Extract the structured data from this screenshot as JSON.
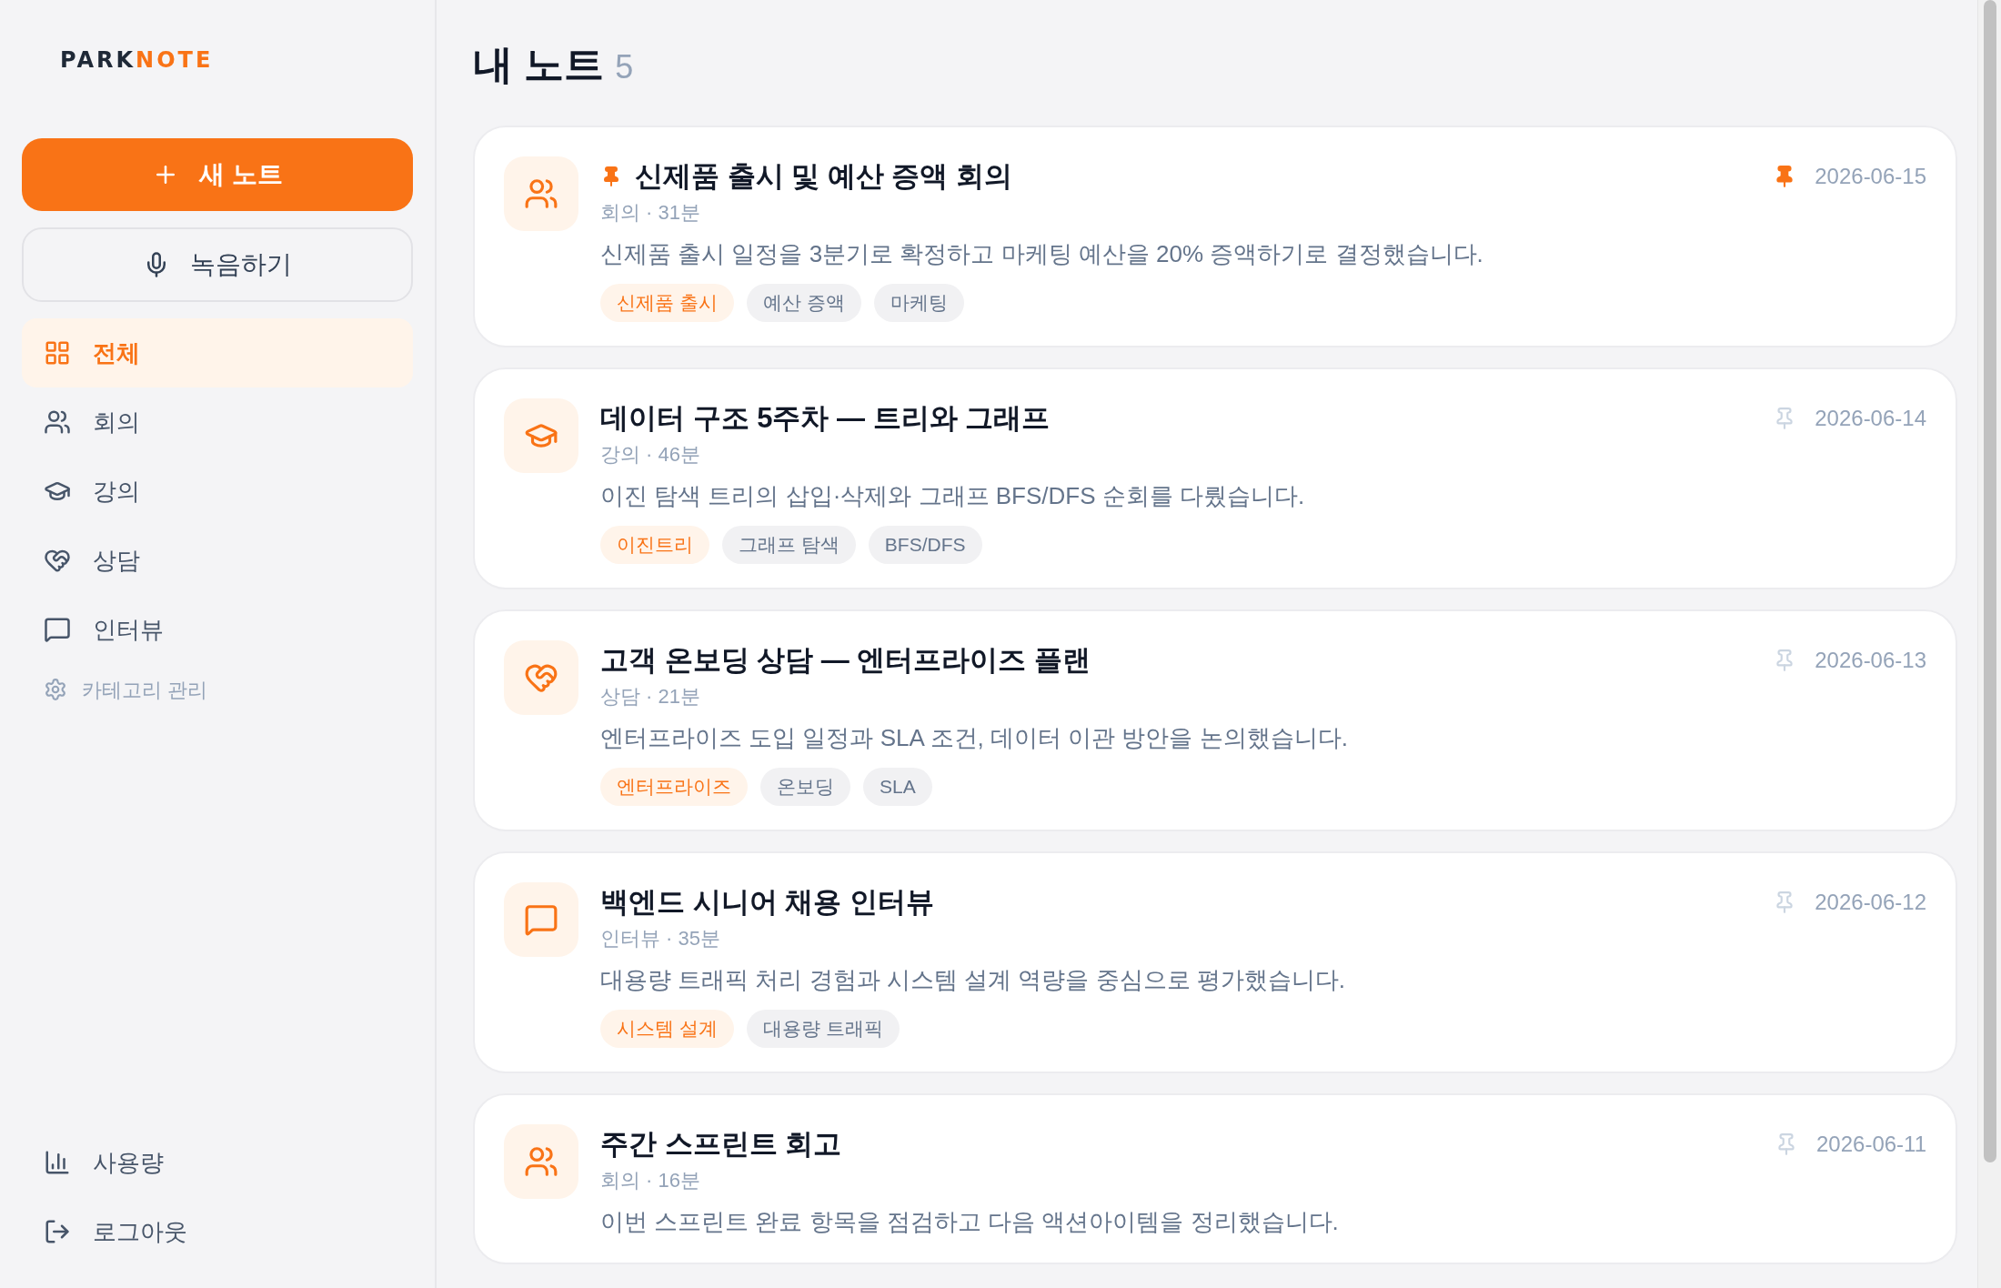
{
  "logo": {
    "part_1": "PARK",
    "part_2": "NOTE"
  },
  "new_note_button": {
    "label": "새 노트"
  },
  "record_button": {
    "label": "녹음하기"
  },
  "sidebar": {
    "items": [
      {
        "kind": "all",
        "label": "전체",
        "selected": true
      },
      {
        "kind": "meeting",
        "label": "회의",
        "selected": false
      },
      {
        "kind": "lecture",
        "label": "강의",
        "selected": false
      },
      {
        "kind": "consult",
        "label": "상담",
        "selected": false
      },
      {
        "kind": "interview",
        "label": "인터뷰",
        "selected": false
      },
      {
        "kind": "manage",
        "label": "카테고리 관리",
        "selected": false
      }
    ],
    "bottom_items": [
      {
        "kind": "usage",
        "label": "사용량"
      },
      {
        "kind": "logout",
        "label": "로그아웃"
      }
    ]
  },
  "page": {
    "title": "내 노트",
    "count": "5"
  },
  "notes": [
    {
      "kind": "meeting",
      "pinned": true,
      "title": "신제품 출시 및 예산 증액 회의",
      "meta": "회의 · 31분",
      "date": "2026-06-15",
      "summary": "신제품 출시 일정을 3분기로 확정하고 마케팅 예산을 20% 증액하기로 결정했습니다.",
      "tags": [
        {
          "label": "신제품 출시",
          "primary": true
        },
        {
          "label": "예산 증액",
          "primary": false
        },
        {
          "label": "마케팅",
          "primary": false
        }
      ]
    },
    {
      "kind": "lecture",
      "pinned": false,
      "title": "데이터 구조 5주차 — 트리와 그래프",
      "meta": "강의 · 46분",
      "date": "2026-06-14",
      "summary": "이진 탐색 트리의 삽입·삭제와 그래프 BFS/DFS 순회를 다뤘습니다.",
      "tags": [
        {
          "label": "이진트리",
          "primary": true
        },
        {
          "label": "그래프 탐색",
          "primary": false
        },
        {
          "label": "BFS/DFS",
          "primary": false
        }
      ]
    },
    {
      "kind": "consult",
      "pinned": false,
      "title": "고객 온보딩 상담 — 엔터프라이즈 플랜",
      "meta": "상담 · 21분",
      "date": "2026-06-13",
      "summary": "엔터프라이즈 도입 일정과 SLA 조건, 데이터 이관 방안을 논의했습니다.",
      "tags": [
        {
          "label": "엔터프라이즈",
          "primary": true
        },
        {
          "label": "온보딩",
          "primary": false
        },
        {
          "label": "SLA",
          "primary": false
        }
      ]
    },
    {
      "kind": "interview",
      "pinned": false,
      "title": "백엔드 시니어 채용 인터뷰",
      "meta": "인터뷰 · 35분",
      "date": "2026-06-12",
      "summary": "대용량 트래픽 처리 경험과 시스템 설계 역량을 중심으로 평가했습니다.",
      "tags": [
        {
          "label": "시스템 설계",
          "primary": true
        },
        {
          "label": "대용량 트래픽",
          "primary": false
        }
      ]
    },
    {
      "kind": "meeting",
      "pinned": false,
      "title": "주간 스프린트 회고",
      "meta": "회의 · 16분",
      "date": "2026-06-11",
      "summary": "이번 스프린트 완료 항목을 점검하고 다음 액션아이템을 정리했습니다."
    }
  ]
}
